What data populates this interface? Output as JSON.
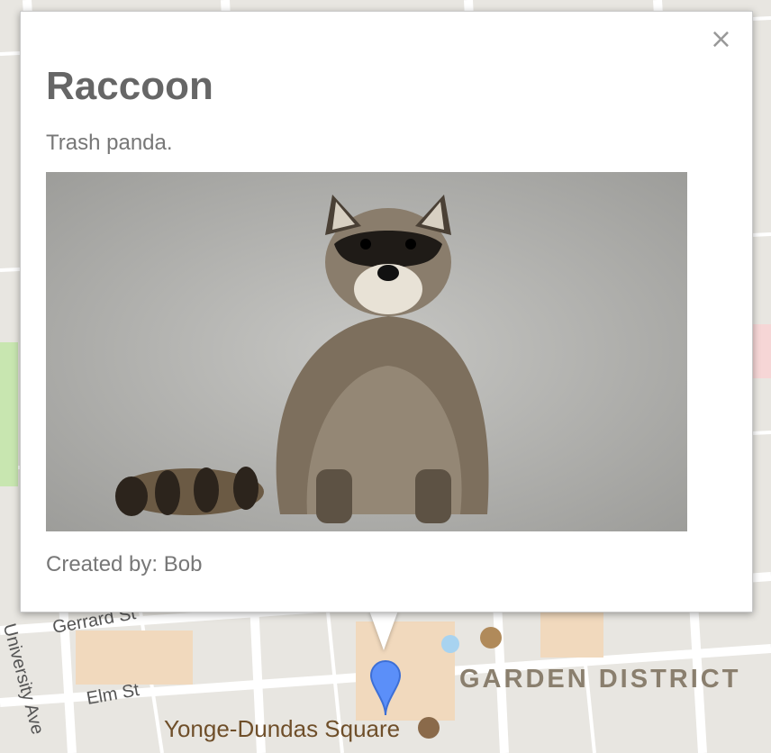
{
  "popup": {
    "title": "Raccoon",
    "description": "Trash panda.",
    "created_by_label": "Created by: ",
    "created_by_value": "Bob",
    "close_glyph": "×"
  },
  "map": {
    "labels": {
      "garden_district": "GARDEN DISTRICT",
      "yonge_dundas": "Yonge-Dundas Square",
      "gerrard": "Gerrard St",
      "elm": "Elm St",
      "university_ave": "University Ave"
    },
    "marker_color": "#5b8ff9"
  }
}
